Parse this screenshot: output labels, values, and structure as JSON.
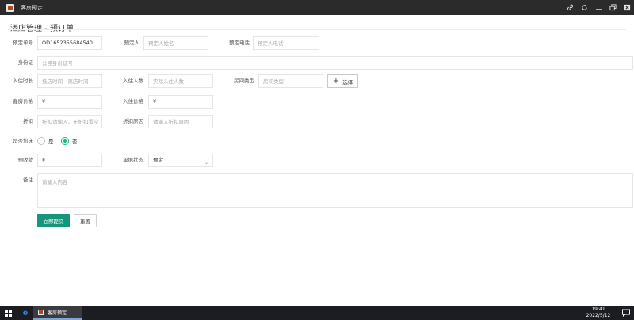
{
  "window": {
    "title": "客房预定"
  },
  "page": {
    "title": "酒店管理 - 预订单"
  },
  "form": {
    "booking_no": {
      "label": "预定单号",
      "value": "OD1652355684540"
    },
    "booker": {
      "label": "预定人",
      "placeholder": "预定人姓名"
    },
    "booker_phone": {
      "label": "预定电话",
      "placeholder": "预定人电话"
    },
    "id_card": {
      "label": "身份证",
      "placeholder": "公民身份证号"
    },
    "stay_duration": {
      "label": "入住时长",
      "placeholder": "抵店时间 - 离店时间"
    },
    "guest_count": {
      "label": "入住人数",
      "placeholder": "实际入住人数"
    },
    "room_type": {
      "label": "房间类型",
      "placeholder": "房间类型",
      "button": "选择"
    },
    "room_price": {
      "label": "客房价格",
      "value": "¥"
    },
    "stay_price": {
      "label": "入住价格",
      "value": "¥"
    },
    "discount": {
      "label": "折扣",
      "placeholder": "折扣请输入，无折扣置空"
    },
    "discount_reason": {
      "label": "折扣原因",
      "placeholder": "请输入折扣原因"
    },
    "extra_bed": {
      "label": "是否加床",
      "options": [
        "是",
        "否"
      ],
      "selected": "否"
    },
    "prepayment": {
      "label": "预收款",
      "value": "¥"
    },
    "status": {
      "label": "单据状态",
      "value": "预定"
    },
    "remarks": {
      "label": "备注",
      "placeholder": "请输入内容"
    }
  },
  "actions": {
    "submit": "立即提交",
    "reset": "重置"
  },
  "taskbar": {
    "app_label": "客房预定",
    "time": "19:41",
    "date": "2022/5/12"
  },
  "colors": {
    "primary": "#16957a",
    "radio_checked": "#16b777",
    "titlebar": "#2b2b2b",
    "taskbar": "#1c1d22"
  }
}
